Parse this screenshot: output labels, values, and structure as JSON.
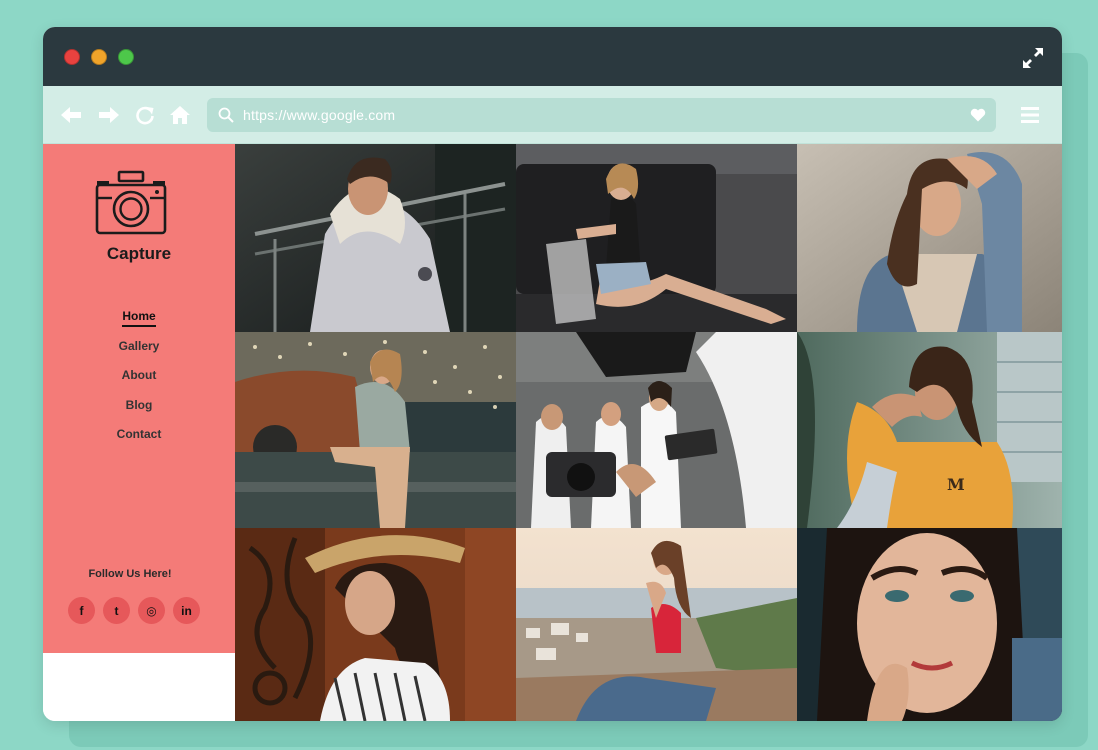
{
  "browser": {
    "url": "https://www.google.com",
    "controls": [
      "close",
      "minimize",
      "maximize"
    ]
  },
  "site": {
    "brand": "Capture",
    "nav": [
      {
        "label": "Home",
        "active": true
      },
      {
        "label": "Gallery",
        "active": false
      },
      {
        "label": "About",
        "active": false
      },
      {
        "label": "Blog",
        "active": false
      },
      {
        "label": "Contact",
        "active": false
      }
    ],
    "follow_label": "Follow Us Here!",
    "socials": [
      {
        "icon": "facebook-icon",
        "glyph": "f"
      },
      {
        "icon": "twitter-icon",
        "glyph": "t"
      },
      {
        "icon": "instagram-icon",
        "glyph": "◎"
      },
      {
        "icon": "linkedin-icon",
        "glyph": "in"
      }
    ]
  },
  "gallery": {
    "photos": [
      "man-in-white-parka",
      "woman-sitting-on-couch",
      "woman-in-denim-jacket",
      "woman-on-vintage-truck",
      "photo-shoot-backstage",
      "woman-in-yellow-sweater",
      "woman-in-straw-hat",
      "woman-sitting-on-rocks",
      "woman-close-up-portrait"
    ]
  },
  "colors": {
    "background": "#8dd7c6",
    "titlebar": "#2b393f",
    "navbar": "#d3ede6",
    "urlbar": "#b7ded4",
    "sidebar": "#f47b78",
    "social_button": "#e6585a"
  }
}
